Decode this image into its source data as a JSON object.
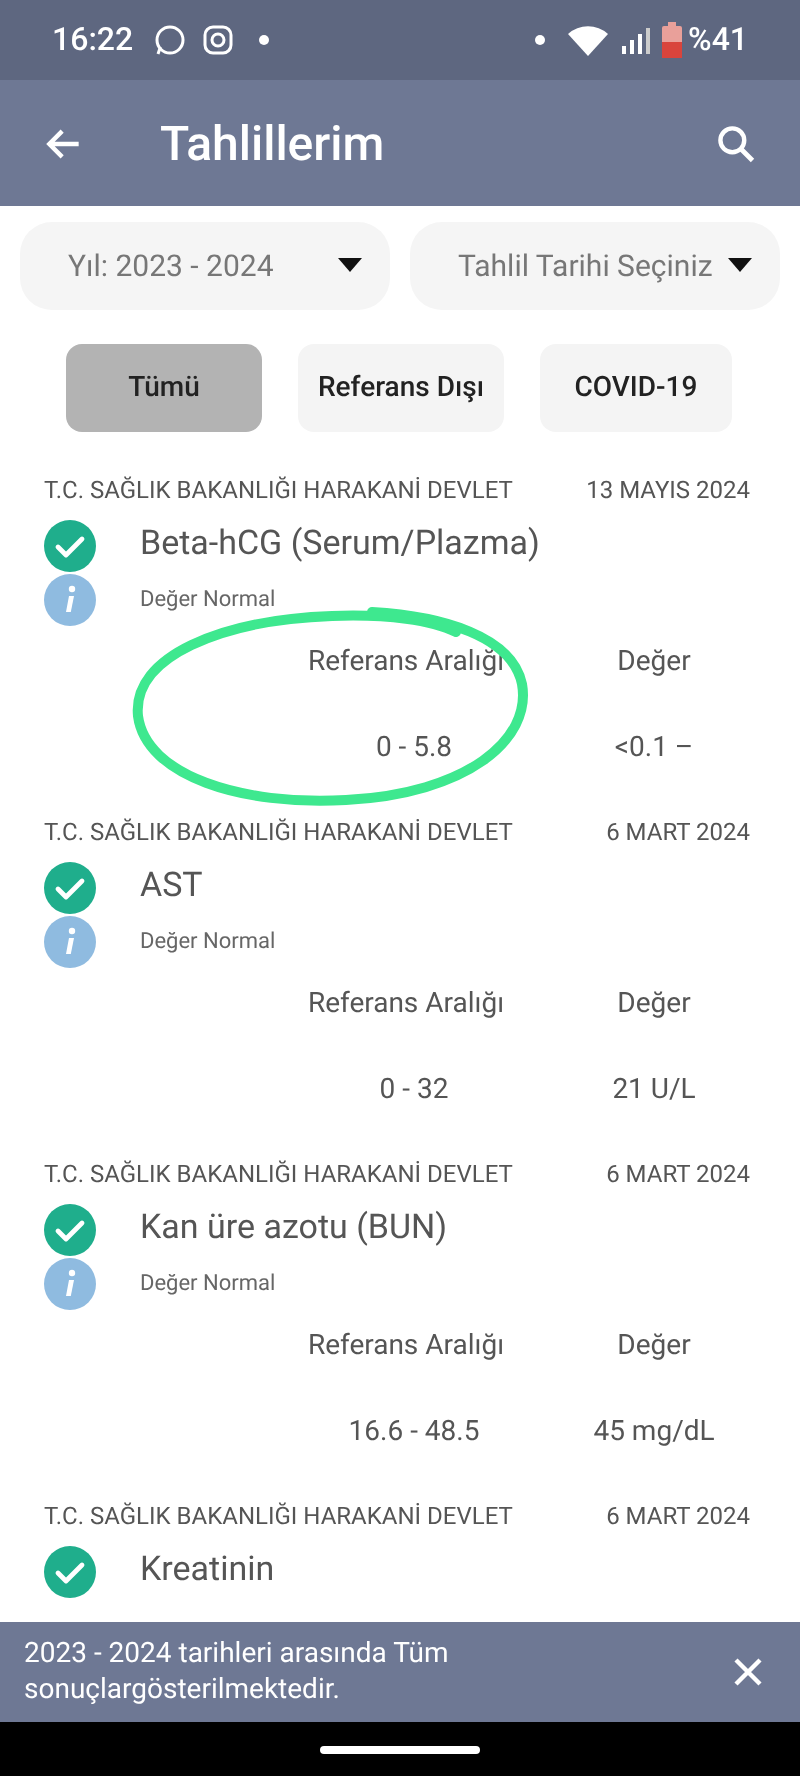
{
  "status_bar": {
    "time": "16:22",
    "battery": "%41"
  },
  "app_bar": {
    "title": "Tahlillerim"
  },
  "filters": [
    {
      "label": "Yıl: 2023 - 2024"
    },
    {
      "label": "Tahlil Tarihi Seçiniz"
    }
  ],
  "tabs": [
    {
      "label": "Tümü",
      "selected": true
    },
    {
      "label": "Referans Dışı",
      "selected": false
    },
    {
      "label": "COVID-19",
      "selected": false
    }
  ],
  "results": [
    {
      "source": "T.C. SAĞLIK BAKANLIĞI HARAKANİ DEVLET",
      "date": "13 MAYIS 2024",
      "name": "Beta-hCG (Serum/Plazma)",
      "status": "Değer Normal",
      "reference_header": "Referans Aralığı",
      "value_header": "Değer",
      "reference": "0 - 5.8",
      "value": "<0.1 –"
    },
    {
      "source": "T.C. SAĞLIK BAKANLIĞI HARAKANİ DEVLET",
      "date": "6 MART 2024",
      "name": "AST",
      "status": "Değer Normal",
      "reference_header": "Referans Aralığı",
      "value_header": "Değer",
      "reference": "0 - 32",
      "value": "21 U/L"
    },
    {
      "source": "T.C. SAĞLIK BAKANLIĞI HARAKANİ DEVLET",
      "date": "6 MART 2024",
      "name": "Kan üre azotu (BUN)",
      "status": "Değer Normal",
      "reference_header": "Referans Aralığı",
      "value_header": "Değer",
      "reference": "16.6 - 48.5",
      "value": "45 mg/dL"
    },
    {
      "source": "T.C. SAĞLIK BAKANLIĞI HARAKANİ DEVLET",
      "date": "6 MART 2024",
      "name": "Kreatinin"
    }
  ],
  "snackbar": {
    "message": "2023 - 2024 tarihleri arasında Tüm sonuçlargösterilmektedir."
  }
}
